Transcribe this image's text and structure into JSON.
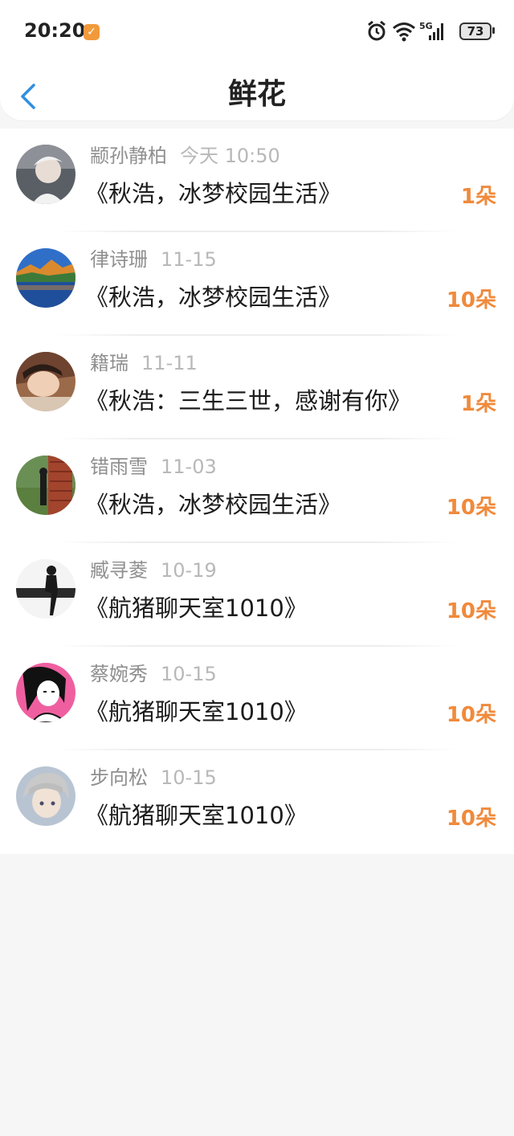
{
  "status_bar": {
    "time": "20:20",
    "app_badge_icon": "check-badge-icon",
    "network": "5G",
    "battery": "73"
  },
  "nav": {
    "title": "鲜花",
    "back_icon": "chevron-left-icon"
  },
  "flowers": [
    {
      "name": "颛孙静柏",
      "date": "今天 10:50",
      "work": "《秋浩，冰梦校园生活》",
      "count": "1朵"
    },
    {
      "name": "律诗珊",
      "date": "11-15",
      "work": "《秋浩，冰梦校园生活》",
      "count": "10朵"
    },
    {
      "name": "籍瑞",
      "date": "11-11",
      "work": "《秋浩：三生三世，感谢有你》",
      "count": "1朵"
    },
    {
      "name": "错雨雪",
      "date": "11-03",
      "work": "《秋浩，冰梦校园生活》",
      "count": "10朵"
    },
    {
      "name": "臧寻菱",
      "date": "10-19",
      "work": "《航猪聊天室1010》",
      "count": "10朵"
    },
    {
      "name": "蔡婉秀",
      "date": "10-15",
      "work": "《航猪聊天室1010》",
      "count": "10朵"
    },
    {
      "name": "步向松",
      "date": "10-15",
      "work": "《航猪聊天室1010》",
      "count": "10朵"
    }
  ],
  "colors": {
    "accent_back": "#2f8fe0",
    "count": "#f08a3c",
    "name": "#8f8f8f",
    "date": "#b8b8b8"
  }
}
